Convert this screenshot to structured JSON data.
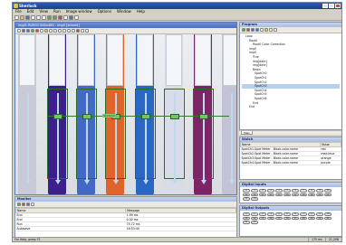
{
  "app": {
    "title": "Sherlock"
  },
  "menu": [
    "File",
    "Edit",
    "View",
    "Run",
    "Image window",
    "Options",
    "Window",
    "Help"
  ],
  "image_window": {
    "title": "img0: RGB32 640x480 - img0 [shared]",
    "center_label": "SpotCh0"
  },
  "program": {
    "title": "Program",
    "tree": [
      "Loop",
      "Root0",
      "Root0 Color Correction",
      "img0",
      "img0",
      "True",
      "img[date]",
      "img[date]",
      "Begin",
      "SpotCh0",
      "SpotCh1",
      "SpotCh2",
      "SpotCh3",
      "SpotCh4",
      "SpotCh5",
      "SpotCh6",
      "End",
      "End"
    ],
    "tabs": [
      "Main"
    ]
  },
  "watch": {
    "title": "Watch",
    "columns": [
      "Name",
      "Value"
    ],
    "rows": [
      {
        "name": "SpotCh1.Spot Meter - Block.color.name",
        "value": "red"
      },
      {
        "name": "SpotCh2.Spot Meter - Block.color.name",
        "value": "med.blue"
      },
      {
        "name": "SpotCh3.Spot Meter - Block.color.name",
        "value": "orange"
      },
      {
        "name": "SpotCh4.Spot Meter - Block.color.name",
        "value": "purple"
      }
    ]
  },
  "digital_inputs": {
    "title": "Digital Inputs",
    "leds": [
      "0",
      "1",
      "2",
      "3",
      "4",
      "5",
      "6",
      "7",
      "8",
      "9",
      "10",
      "11",
      "12",
      "13",
      "14",
      "15",
      "16",
      "17",
      "18",
      "19",
      "20",
      "21",
      "22",
      "23"
    ]
  },
  "digital_outputs": {
    "title": "Digital Outputs",
    "leds": [
      "0",
      "1",
      "2",
      "3",
      "4",
      "5",
      "6",
      "7",
      "8",
      "9",
      "10",
      "11",
      "12",
      "13",
      "14",
      "15",
      "16",
      "17",
      "18",
      "19",
      "20",
      "21",
      "22",
      "23"
    ]
  },
  "monitor": {
    "title": "Monitor",
    "columns": [
      "Name",
      "Message"
    ],
    "rows": [
      {
        "name": "End",
        "message": "1.99 ms"
      },
      {
        "name": "End",
        "message": "0.00 ms"
      },
      {
        "name": "Run",
        "message": "75.72 ms"
      },
      {
        "name": "Autosave",
        "message": "16:53:40"
      }
    ]
  },
  "status": {
    "help": "For Help, press F1",
    "cell1": "175 ms",
    "cell2": "21,208"
  },
  "colors": {
    "tubes": [
      "#c8cad8",
      "#3b1f8a",
      "#4468c6",
      "#e0642a",
      "#2a66c4",
      "#d8dbe8",
      "#7c2466",
      "#c2c4d6"
    ]
  }
}
